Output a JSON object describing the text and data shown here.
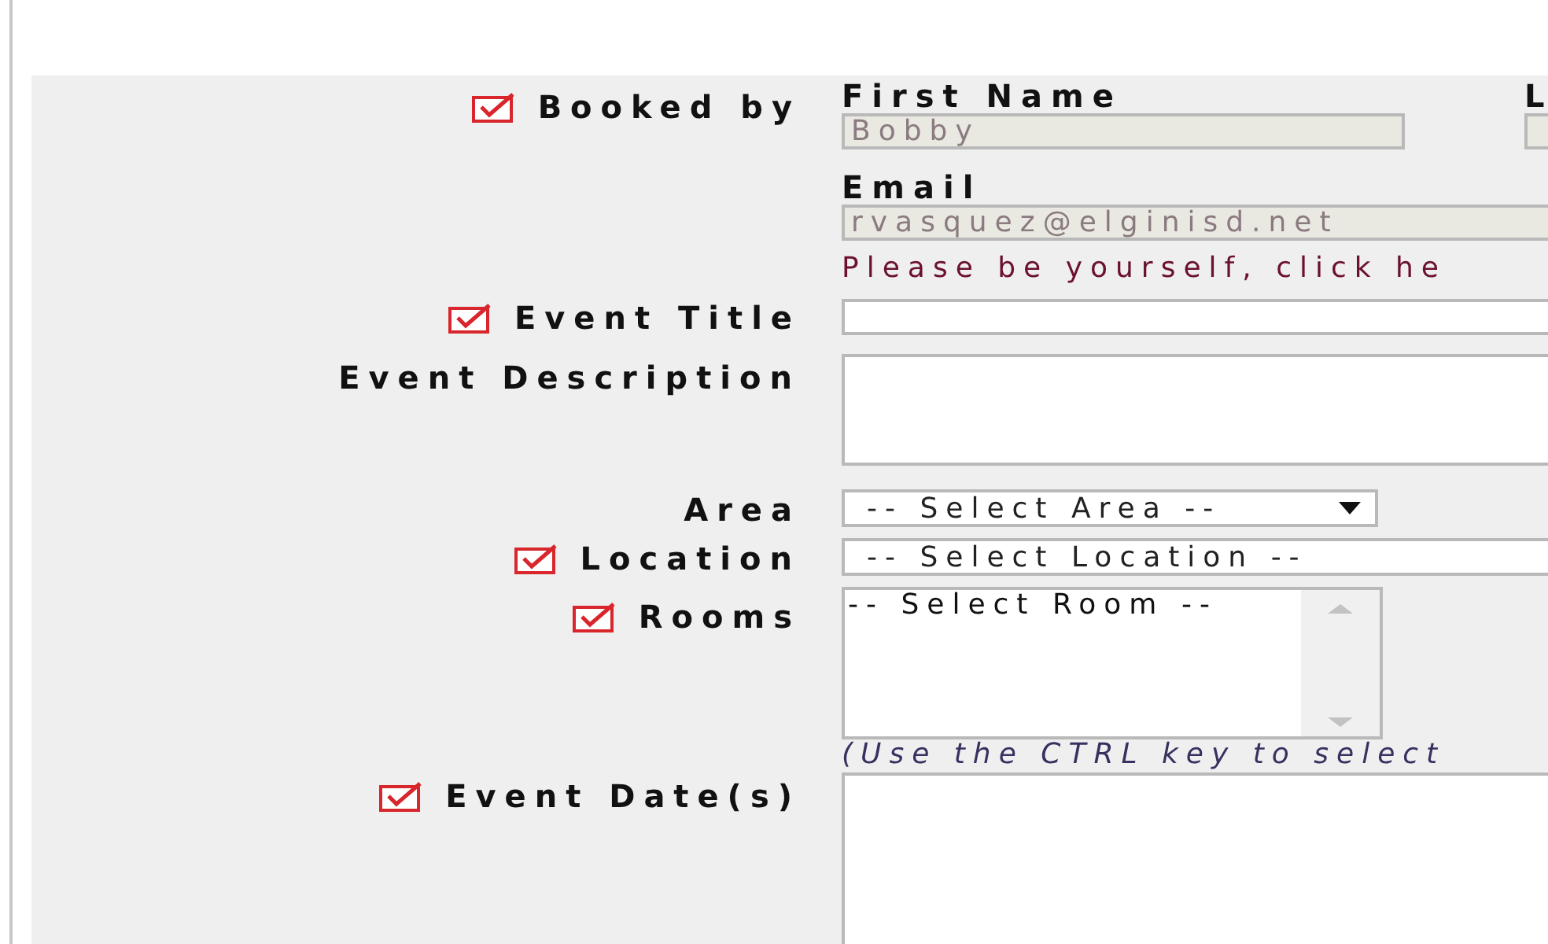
{
  "booked_by": {
    "label": "Booked by",
    "required": true,
    "first_name": {
      "label": "First Name",
      "value": "Bobby",
      "disabled": true
    },
    "last_name": {
      "label": "L",
      "disabled": true
    },
    "email": {
      "label": "Email",
      "value": "rvasquez@elginisd.net",
      "disabled": true
    },
    "notice": "Please be yourself, click he"
  },
  "fields": [
    {
      "kind": "text",
      "label": "Event Title",
      "required": true
    },
    {
      "kind": "textarea",
      "label": "Event Description",
      "required": false
    },
    {
      "kind": "select",
      "label": "Area",
      "required": false,
      "value": "-- Select Area --"
    },
    {
      "kind": "wide-select",
      "label": "Location",
      "required": true,
      "value": "-- Select Location --"
    },
    {
      "kind": "listbox",
      "label": "Rooms",
      "required": true,
      "options": [
        "-- Select Room --"
      ],
      "hint": "(Use the CTRL key to select"
    },
    {
      "kind": "textarea",
      "label": "Event Date(s)",
      "required": true
    }
  ]
}
